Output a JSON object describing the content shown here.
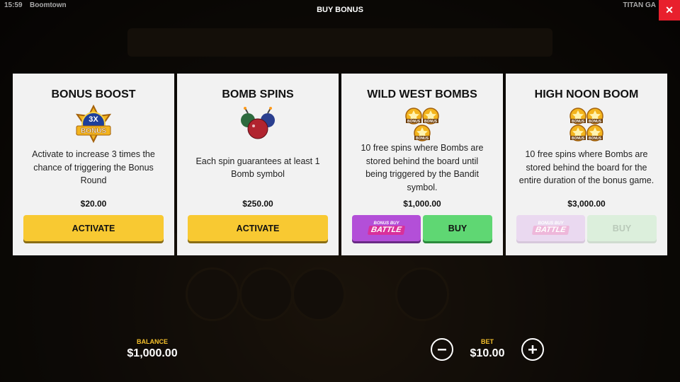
{
  "status_bar": {
    "time": "15:59",
    "game_name": "Boomtown",
    "provider": "TITAN GA"
  },
  "dialog": {
    "title": "BUY BONUS",
    "close_icon": "close-icon"
  },
  "cards": [
    {
      "title": "BONUS BOOST",
      "icon": "3x-bonus-badge-icon",
      "badge_top": "3X",
      "badge_bottom": "BONUS",
      "description": "Activate to increase 3 times the chance of triggering the Bonus Round",
      "price": "$20.00",
      "button": "ACTIVATE"
    },
    {
      "title": "BOMB SPINS",
      "icon": "bombs-icon",
      "description": "Each spin guarantees at least 1 Bomb symbol",
      "price": "$250.00",
      "button": "ACTIVATE"
    },
    {
      "title": "WILD WEST BOMBS",
      "icon": "three-bonus-stars-icon",
      "star_label": "BONUS",
      "description": "10 free spins where Bombs are stored behind the board until being triggered by the Bandit symbol.",
      "price": "$1,000.00",
      "battle_small": "BONUS BUY",
      "battle_big": "BATTLE",
      "button": "BUY"
    },
    {
      "title": "HIGH NOON BOOM",
      "icon": "four-bonus-stars-icon",
      "star_label": "BONUS",
      "description": "10 free spins where Bombs are stored behind the board for the entire duration of the bonus game.",
      "price": "$3,000.00",
      "battle_small": "BONUS BUY",
      "battle_big": "BATTLE",
      "button": "BUY"
    }
  ],
  "footer": {
    "balance_label": "BALANCE",
    "balance_value": "$1,000.00",
    "bet_label": "BET",
    "bet_value": "$10.00"
  },
  "colors": {
    "activate": "#f8c932",
    "buy": "#5fd773",
    "battle": "#b34fd8",
    "close": "#e8202d",
    "label_gold": "#f6c12b"
  }
}
